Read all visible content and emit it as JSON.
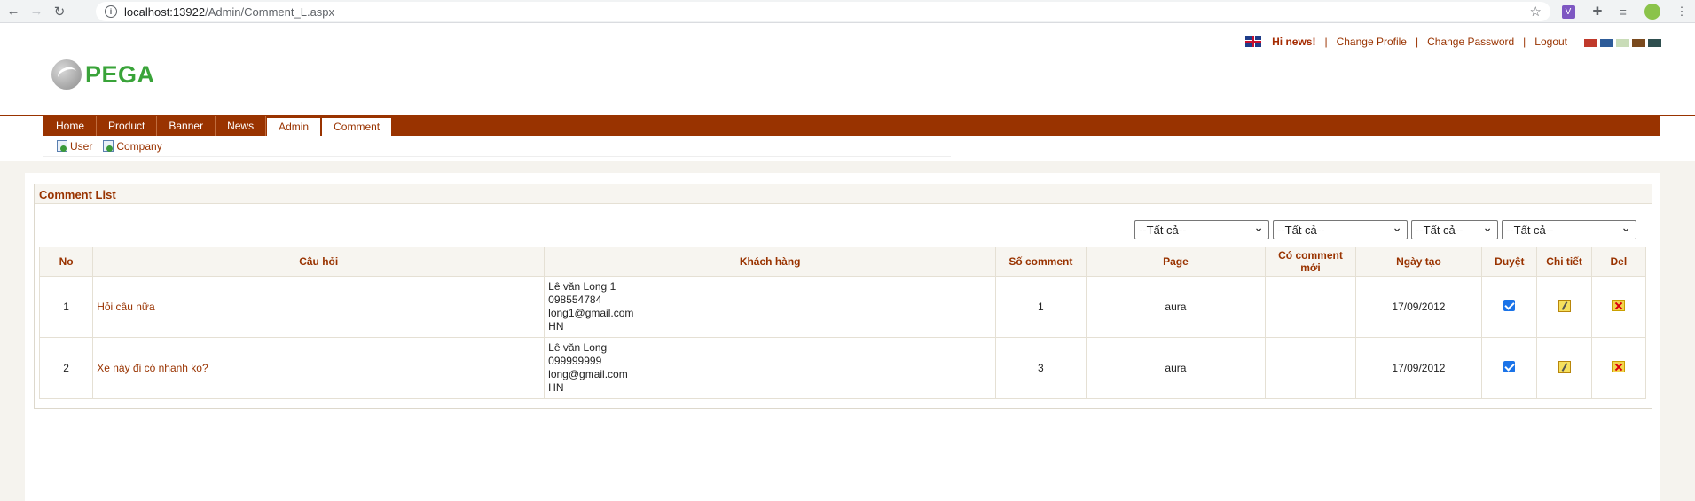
{
  "browser": {
    "url_host": "localhost:13922",
    "url_path": "/Admin/Comment_L.aspx"
  },
  "brand": {
    "logo_text": "PEGA"
  },
  "toplinks": {
    "greeting": "Hi news!",
    "change_profile": "Change Profile",
    "change_password": "Change Password",
    "logout": "Logout",
    "separator": "|"
  },
  "theme_colors": [
    "#c0392b",
    "#2e5c99",
    "#c9dcb8",
    "#7a4a1e",
    "#2f4f4f"
  ],
  "menu": [
    {
      "label": "Home",
      "active": false
    },
    {
      "label": "Product",
      "active": false
    },
    {
      "label": "Banner",
      "active": false
    },
    {
      "label": "News",
      "active": false
    },
    {
      "label": "Admin",
      "active": true
    },
    {
      "label": "Comment",
      "active": true
    }
  ],
  "submenu": [
    {
      "label": "User"
    },
    {
      "label": "Company"
    }
  ],
  "panel": {
    "title": "Comment List"
  },
  "filters": [
    "--Tất cả--",
    "--Tất cả--",
    "--Tất cả--",
    "--Tất cả--"
  ],
  "table": {
    "headers": [
      "No",
      "Câu hỏi",
      "Khách hàng",
      "Số comment",
      "Page",
      "Có comment mới",
      "Ngày tạo",
      "Duyệt",
      "Chi tiết",
      "Del"
    ],
    "rows": [
      {
        "no": "1",
        "question": "Hỏi câu nữa",
        "customer": [
          "Lê văn Long 1",
          "098554784",
          "long1@gmail.com",
          "HN"
        ],
        "comments": "1",
        "page": "aura",
        "new_comment": "",
        "date": "17/09/2012",
        "approved": true
      },
      {
        "no": "2",
        "question": "Xe này đi có nhanh ko?",
        "customer": [
          "Lê văn Long",
          "099999999",
          "long@gmail.com",
          "HN"
        ],
        "comments": "3",
        "page": "aura",
        "new_comment": "",
        "date": "17/09/2012",
        "approved": true
      }
    ]
  }
}
